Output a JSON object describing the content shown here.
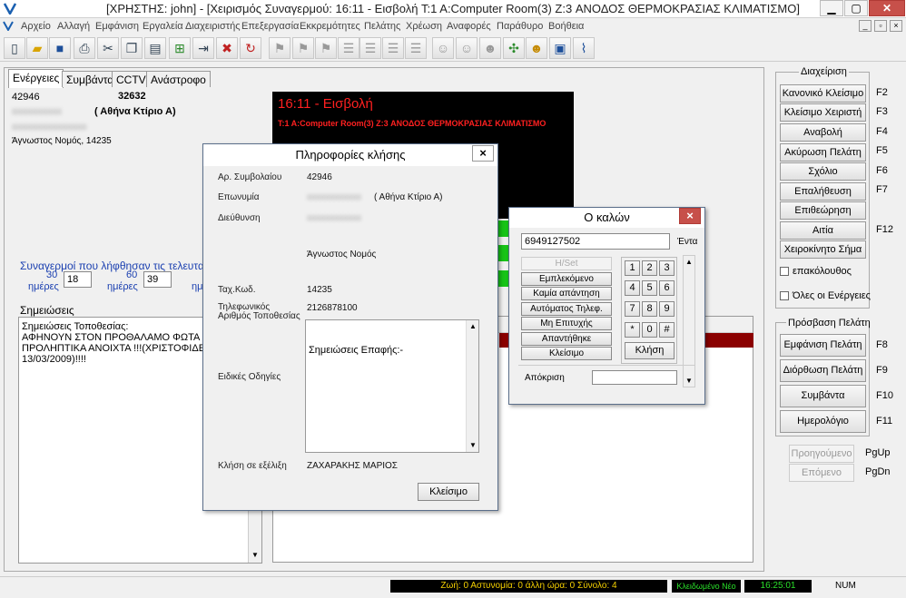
{
  "window": {
    "title": "[ΧΡΗΣΤΗΣ: john] - [Χειρισμός Συναγερμού: 16:11 - Εισβολή T:1 A:Computer Room(3) Z:3 ΑΝΟΔΟΣ ΘΕΡΜΟΚΡΑΣΙΑΣ ΚΛΙΜΑΤΙΣΜΟ]",
    "minimize": "▁",
    "maximize": "▢",
    "close": "✕"
  },
  "menu": [
    "Αρχείο",
    "Αλλαγή",
    "Εμφάνιση",
    "Εργαλεία",
    "Διαχειριστής",
    "Επεξεργασία",
    "Εκκρεμότητες",
    "Πελάτης",
    "Χρέωση",
    "Αναφορές",
    "Παράθυρο",
    "Βοήθεια"
  ],
  "mdi": {
    "minimize": "_",
    "restore": "▫",
    "close": "×"
  },
  "tabs": [
    "Ενέργειες",
    "Συμβάντα",
    "CCTV",
    "Ανάστροφο"
  ],
  "account": {
    "code": "42946",
    "number": "32632",
    "name_blurred": "xxxxxxxxxx",
    "name": "( Αθήνα Κτίριο Α)",
    "address_blurred": "xxxxxxxxxxxxxxx",
    "region": "Άγνωστος Νομός, 14235"
  },
  "alarm": {
    "title": "16:11 - Εισβολή",
    "detail": "T:1 A:Computer Room(3) Z:3 ΑΝΟΔΟΣ ΘΕΡΜΟΚΡΑΣΙΑΣ ΚΛΙΜΑΤΙΣΜΟ"
  },
  "recent": {
    "label": "Συναγερμοί που λήφθησαν τις τελευταίες",
    "periods": [
      {
        "days": "30",
        "unit": "ημέρες",
        "count": "18"
      },
      {
        "days": "60",
        "unit": "ημέρες",
        "count": "39"
      }
    ],
    "trailing_unit": "ημ"
  },
  "notes": {
    "label": "Σημειώσεις",
    "text": "Σημειώσεις Τοποθεσίας:\nΑΦΗΝΟΥΝ ΣΤΟΝ ΠΡΟΘΑΛΑΜΟ ΦΩΤΑ\nΠΡΟΛΗΠΤΙΚΑ ΑΝΟΙΧΤΑ !!!(ΧΡΙΣΤΟΦΙΔΕΛΗ\n13/03/2009)!!!!"
  },
  "right_panel": {
    "management_title": "Διαχείριση",
    "buttons": [
      {
        "label": "Κανονικό Κλείσιμο",
        "key": "F2"
      },
      {
        "label": "Κλείσιμο Χειριστή",
        "key": "F3"
      },
      {
        "label": "Αναβολή",
        "key": "F4"
      },
      {
        "label": "Ακύρωση Πελάτη",
        "key": "F5"
      },
      {
        "label": "Σχόλιο",
        "key": "F6"
      },
      {
        "label": "Επαλήθευση",
        "key": "F7"
      },
      {
        "label": "Επιθεώρηση",
        "key": ""
      },
      {
        "label": "Αιτία",
        "key": "F12"
      },
      {
        "label": "Χειροκίνητο Σήμα",
        "key": ""
      }
    ],
    "checkbox_next": "επακόλουθος",
    "checkbox_all": "Όλες οι Ενέργειες",
    "access_title": "Πρόσβαση Πελάτη",
    "access_buttons": [
      {
        "label": "Εμφάνιση Πελάτη",
        "key": "F8"
      },
      {
        "label": "Διόρθωση Πελάτη",
        "key": "F9"
      },
      {
        "label": "Συμβάντα",
        "key": "F10"
      },
      {
        "label": "Ημερολόγιο",
        "key": "F11"
      }
    ],
    "prev_label": "Προηγούμενο",
    "prev_key": "PgUp",
    "next_label": "Επόμενο",
    "next_key": "PgDn"
  },
  "status": {
    "counts": "Ζωή: 0 Αστυνομία: 0 άλλη ώρα: 0 Σύνολο: 4",
    "state": "Κλειδωμένο Νέο",
    "time": "16:25:01",
    "num": "NUM"
  },
  "info_dialog": {
    "title": "Πληροφορίες κλήσης",
    "close": "×",
    "contract_label": "Αρ. Συμβολαίου",
    "contract": "42946",
    "name_label": "Επωνυμία",
    "name_blurred": "xxxxxxxxxxxx",
    "name": "( Αθήνα Κτίριο Α)",
    "address_label": "Διεύθυνση",
    "address_blurred": "xxxxxxxxxxxx",
    "region": "Άγνωστος Νομός",
    "postcode_label": "Ταχ.Κωδ.",
    "postcode": "14235",
    "phone_label": "Τηλεφωνικός Αριθμός Τοποθεσίας",
    "phone": "2126878100",
    "instructions_label": "Ειδικές Οδηγίες",
    "contact_notes": "Σημειώσεις Επαφής:-",
    "in_progress_label": "Κλήση σε εξέλιξη",
    "in_progress": "ΖΑΧΑΡΑΚΗΣ ΜΑΡΙΟΣ",
    "close_button": "Κλείσιμο"
  },
  "dial_dialog": {
    "title": "Ο καλών",
    "close": "×",
    "number": "6949127502",
    "side_label": "Έντα",
    "buttons": [
      "H/Set",
      "Εμπλεκόμενο",
      "Καμία απάντηση",
      "Αυτόματος Τηλεφ.",
      "Μη Επιτυχής",
      "Απαντήθηκε",
      "Κλείσιμο"
    ],
    "keys": [
      "1",
      "2",
      "3",
      "4",
      "5",
      "6",
      "7",
      "8",
      "9",
      "*",
      "0",
      "#"
    ],
    "call_button": "Κλήση",
    "reply_label": "Απόκριση"
  },
  "icons": [
    "new-file-icon",
    "open-folder-icon",
    "save-icon",
    "print-icon",
    "cut-icon",
    "copy-icon",
    "paste-icon",
    "add-row-icon",
    "indent-icon",
    "delete-icon",
    "refresh-icon",
    "flag-icon",
    "flag-icon",
    "flag-icon",
    "list-icon",
    "list-icon",
    "list-icon",
    "list-icon",
    "users-icon",
    "users-icon",
    "user-icon",
    "tools-icon",
    "user-icon",
    "card-icon",
    "attach-icon"
  ]
}
